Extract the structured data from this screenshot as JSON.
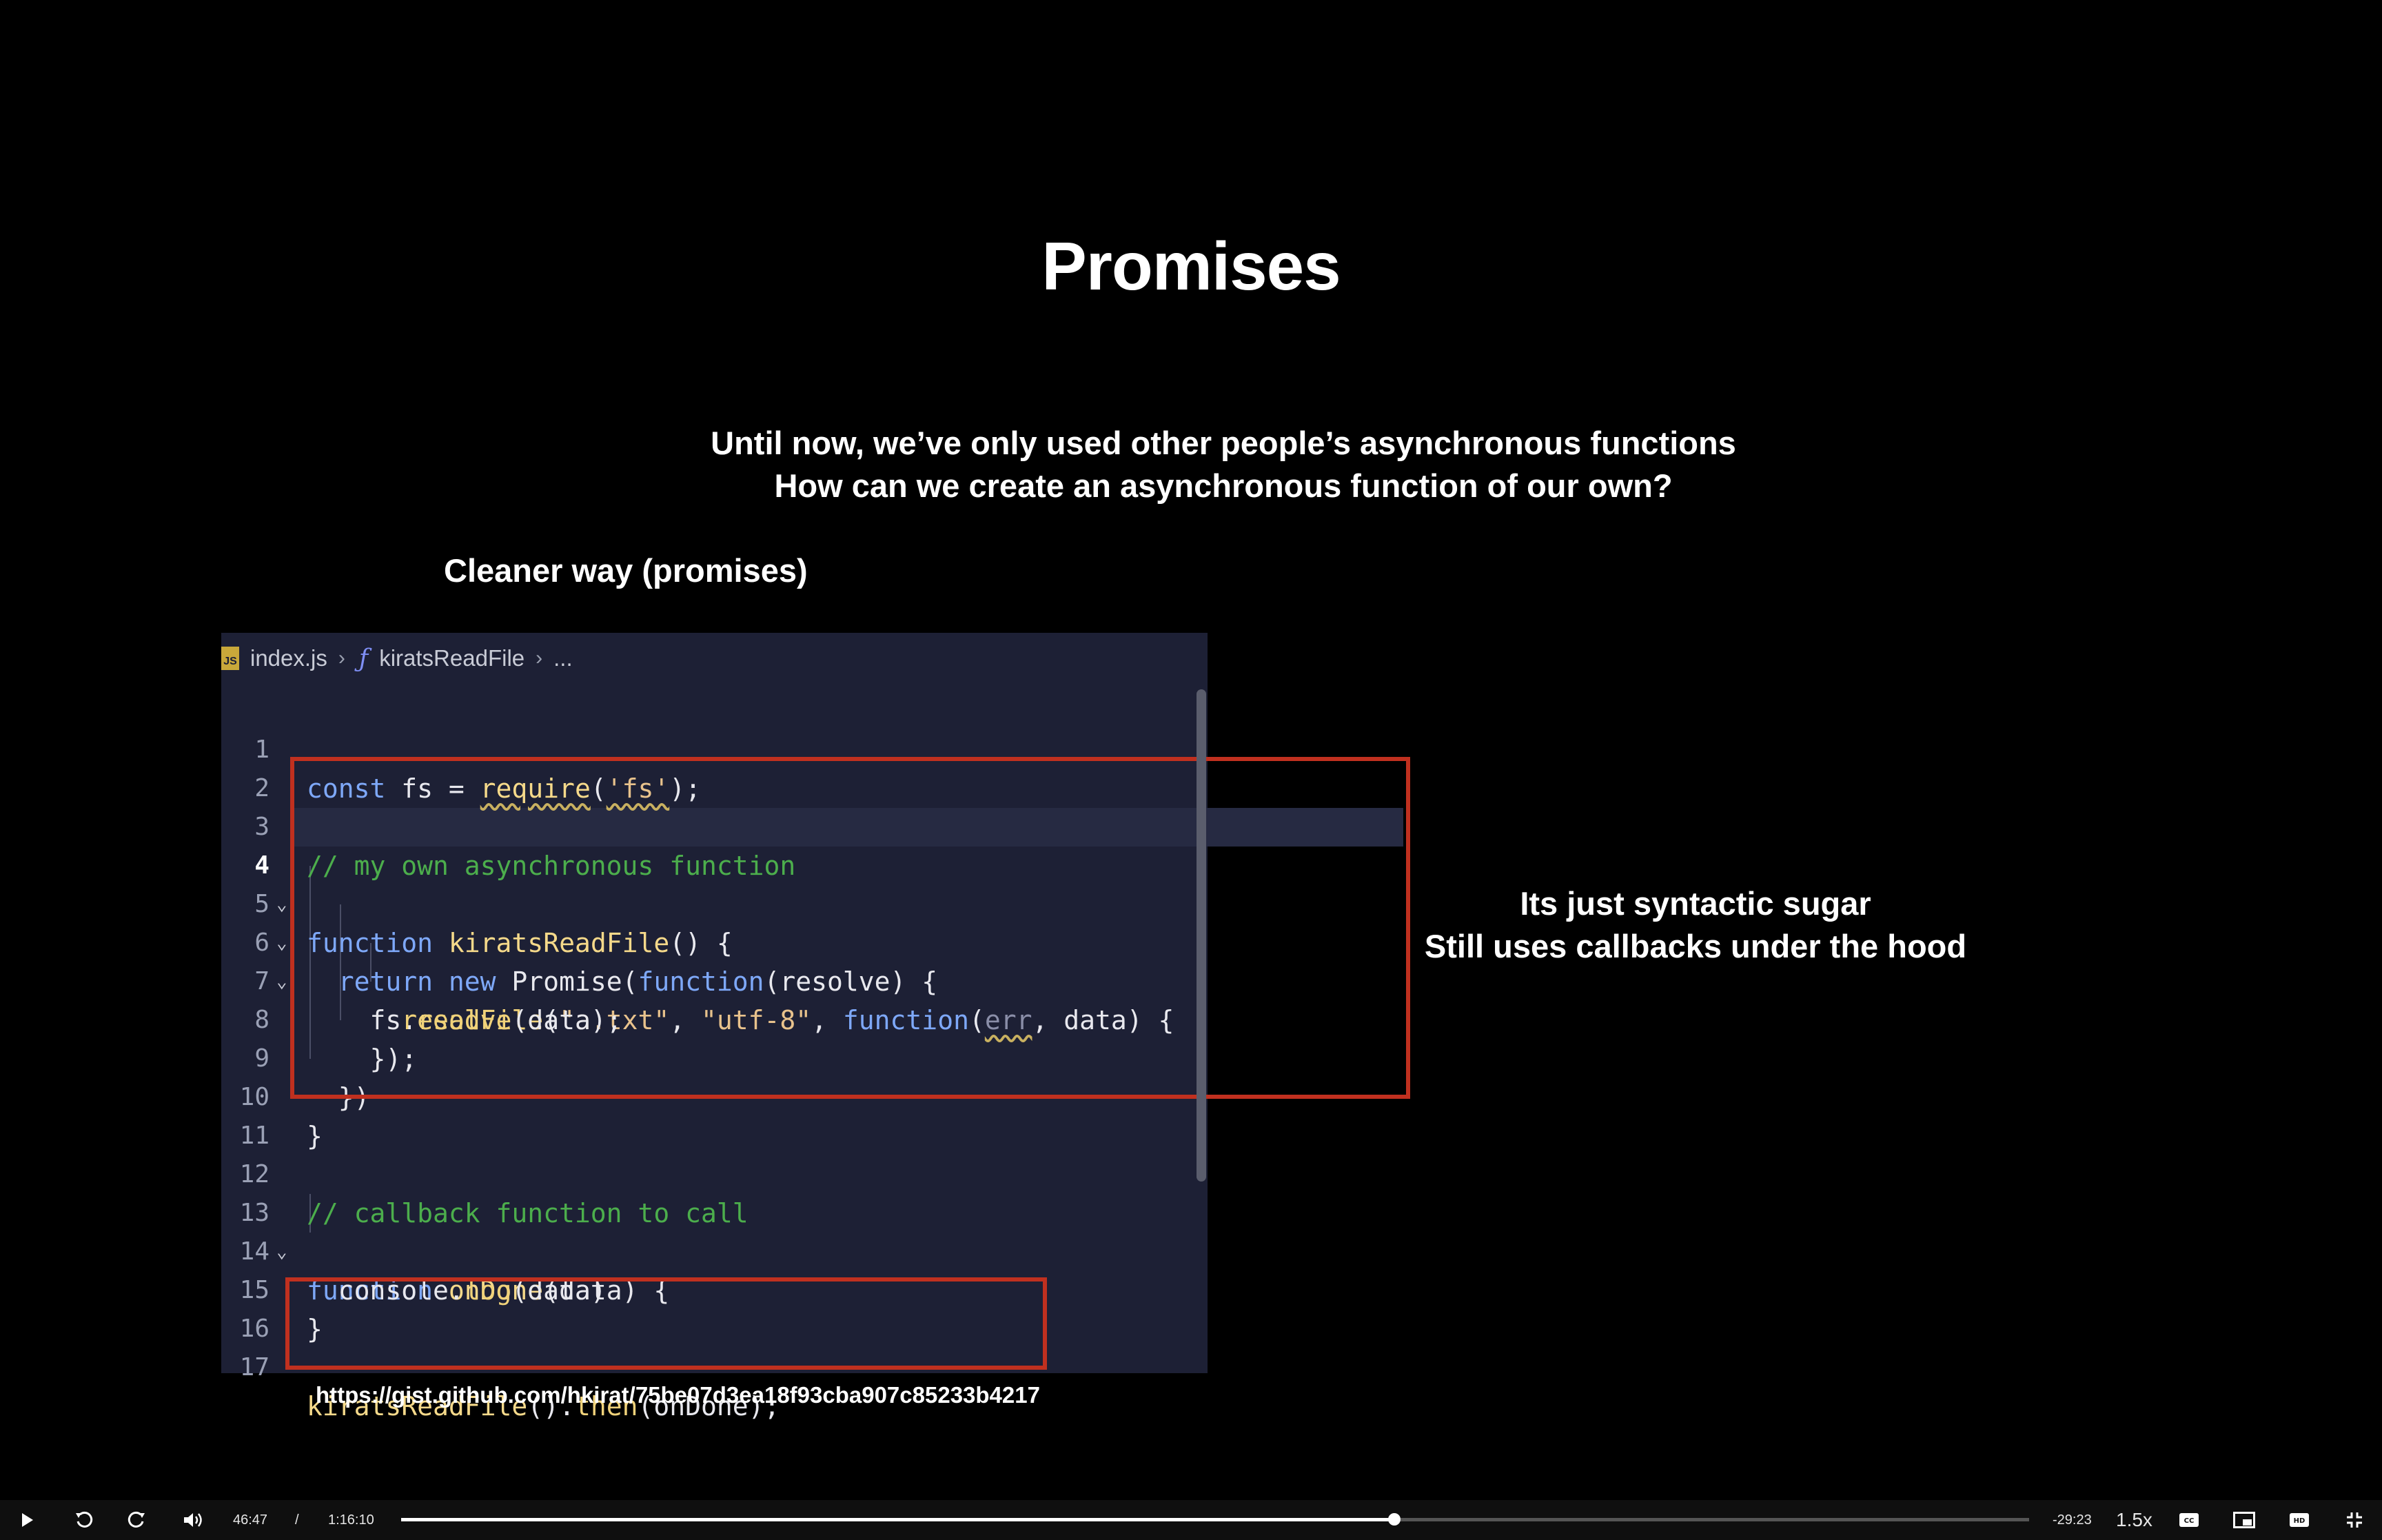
{
  "slide": {
    "title": "Promises",
    "subtitle_line1": "Until now, we’ve only used other people’s asynchronous functions",
    "subtitle_line2": "How can we create an asynchronous function of our own?",
    "left_heading": "Cleaner way (promises)",
    "right_line1": "Its just syntactic sugar",
    "right_line2": "Still uses callbacks under the hood",
    "gist_link": "https://gist.github.com/hkirat/75be07d3ea18f93cba907c85233b4217"
  },
  "editor": {
    "breadcrumb_file": "index.js",
    "breadcrumb_symbol": "kiratsReadFile",
    "breadcrumb_more": "...",
    "file_badge": "JS",
    "code_lines": [
      "const fs = require('fs');",
      "",
      "// my own asynchronous function",
      "function kiratsReadFile() {",
      "  return new Promise(function(resolve) {",
      "    fs.readFile(\"a.txt\", \"utf-8\", function(err, data) {",
      "      resolve(data);",
      "    });",
      "  })",
      "}",
      "",
      "// callback function to call",
      "function onDone(data) {",
      "  console.log(data)",
      "}",
      "",
      "kiratsReadFile().then(onDone);"
    ]
  },
  "player": {
    "current_time": "46:47",
    "separator": "/",
    "total_time": "1:16:10",
    "remaining_time": "-29:23",
    "speed": "1.5x",
    "progress_fraction": 0.61
  },
  "icons": {
    "play": "play-icon",
    "rewind": "rewind-icon",
    "forward": "forward-icon",
    "volume": "volume-icon",
    "captions": "captions-icon",
    "pip": "pip-icon",
    "hd": "hd-icon",
    "fullscreen": "exit-fullscreen-icon"
  }
}
